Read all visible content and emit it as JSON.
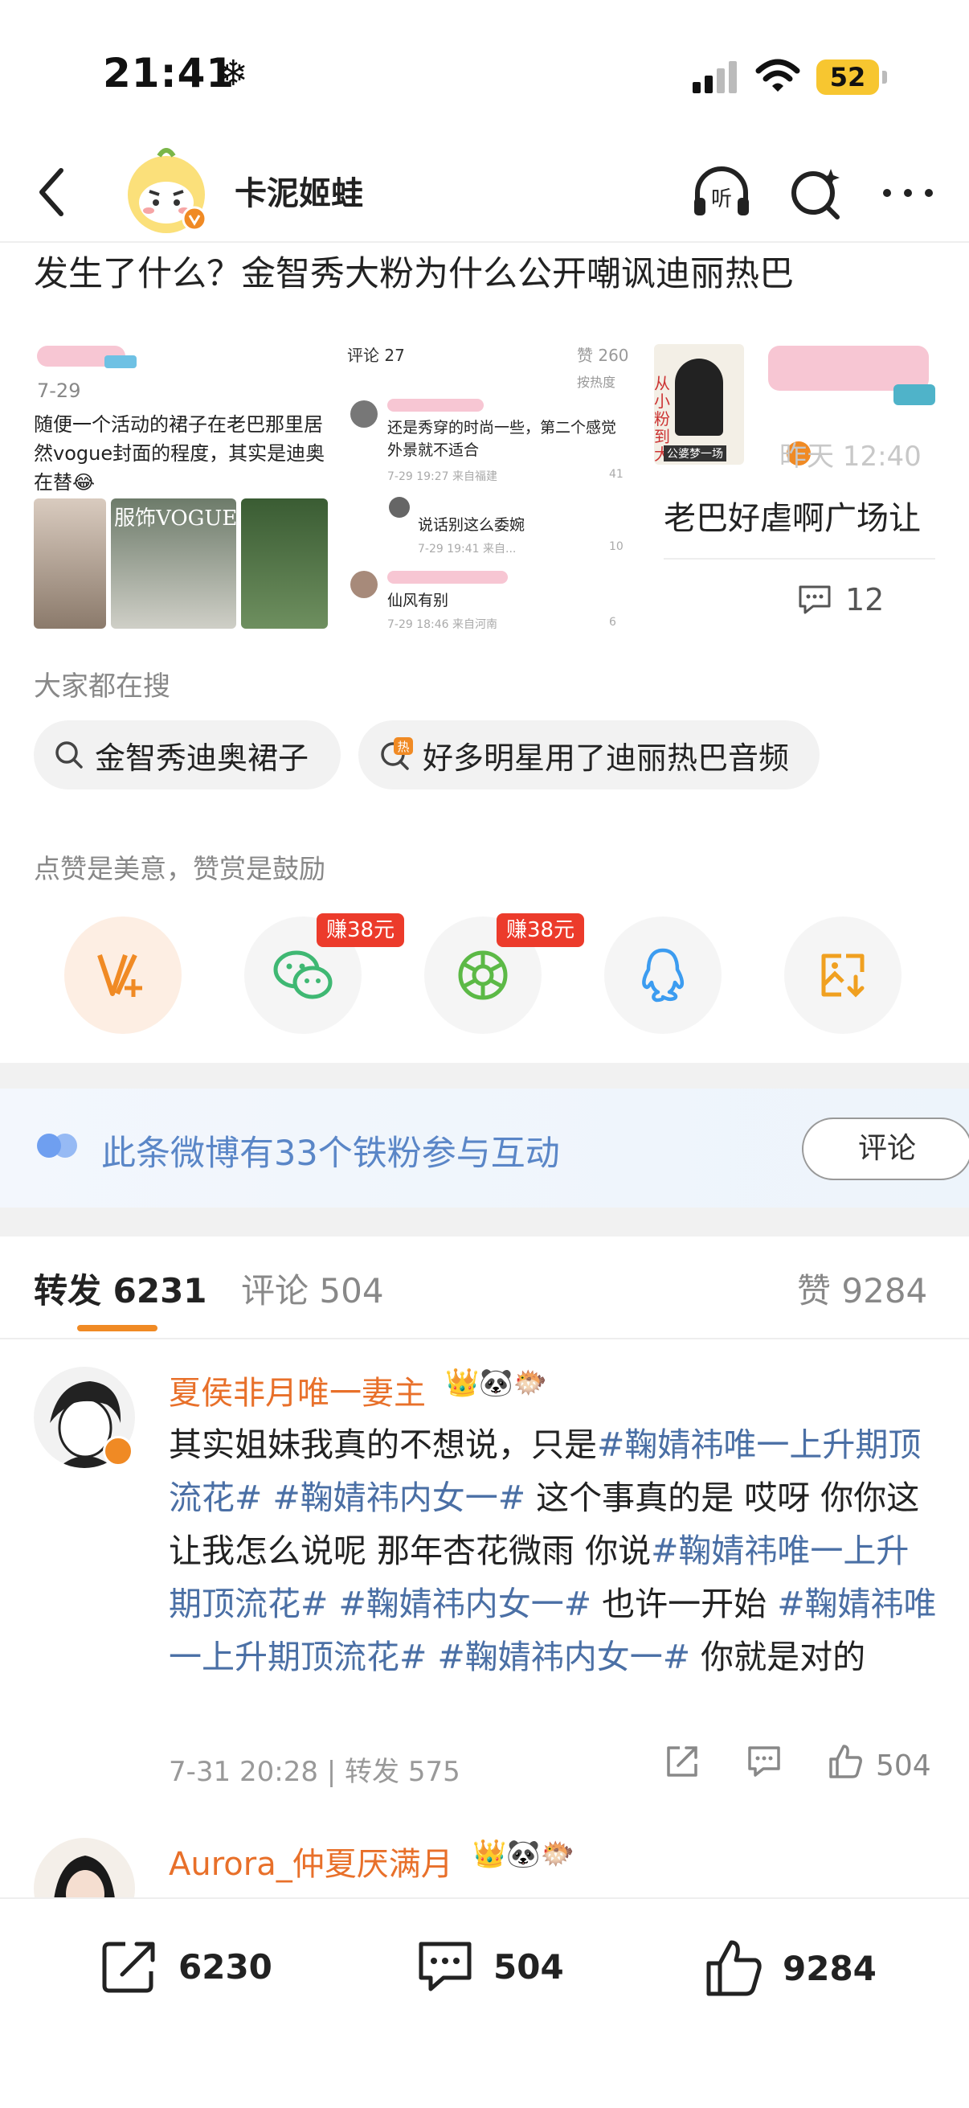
{
  "status_bar": {
    "time": "21:41",
    "weather_icon": "snowflake-icon",
    "battery": "52"
  },
  "nav": {
    "account_name": "卡泥姬蛙"
  },
  "post": {
    "title": "发生了什么？金智秀大粉为什么公开嘲讽迪丽热巴"
  },
  "cards": [
    {
      "date": "7-29",
      "text": "随便一个活动的裙子在老巴那里居然vogue封面的程度，其实是迪奥在替",
      "emoji": "😂",
      "photo_caption": "服饰VOGUE美容"
    },
    {
      "comment_header": "评论 27",
      "likes_header": "赞 260",
      "sort_label": "按热度",
      "comments": [
        {
          "text": "还是秀穿的时尚一些，第二个感觉外景就不适合",
          "meta": "7-29 19:27 来自福建",
          "likes": "41"
        },
        {
          "text": "说话别这么委婉",
          "meta": "7-29 19:41 来自...",
          "likes": "10"
        },
        {
          "text": "仙风有别",
          "meta": "7-29 18:46 来自河南",
          "likes": "6"
        }
      ]
    },
    {
      "time": "昨天 12:40",
      "text": "老巴好虐啊广场让",
      "comment_count": "12",
      "avatar_lines": [
        "从小粉到大",
        "公婆梦一场"
      ]
    }
  ],
  "search": {
    "title": "大家都在搜",
    "items": [
      {
        "label": "金智秀迪奥裙子",
        "icon": "search-icon"
      },
      {
        "label": "好多明星用了迪丽热巴音频",
        "icon": "hot-search-icon"
      }
    ]
  },
  "reward": {
    "note": "点赞是美意，赞赏是鼓励",
    "share_targets": [
      {
        "name": "reward",
        "icon": "v-plus-icon",
        "badge": ""
      },
      {
        "name": "wechat",
        "icon": "wechat-icon",
        "badge": "赚38元"
      },
      {
        "name": "moments",
        "icon": "moments-icon",
        "badge": "赚38元"
      },
      {
        "name": "qq",
        "icon": "qq-icon",
        "badge": ""
      },
      {
        "name": "save",
        "icon": "save-image-icon",
        "badge": ""
      }
    ]
  },
  "fans_banner": {
    "text": "此条微博有33个铁粉参与互动",
    "button": "评论"
  },
  "tabs": {
    "repost_label": "转发",
    "repost_count": "6231",
    "comment_label": "评论",
    "comment_count": "504",
    "like_label": "赞",
    "like_count": "9284"
  },
  "comments": [
    {
      "username": "夏侯非月唯一妻主",
      "parts": [
        {
          "t": "其实姐妹我真的不想说，只是",
          "tag": false
        },
        {
          "t": "#鞠婧祎唯一上升期顶流花#",
          "tag": true
        },
        {
          "t": " ",
          "tag": false
        },
        {
          "t": "#鞠婧祎内女一#",
          "tag": true
        },
        {
          "t": " 这个事真的是 哎呀 你你这让我怎么说呢 那年杏花微雨 你说",
          "tag": false
        },
        {
          "t": "#鞠婧祎唯一上升期顶流花#",
          "tag": true
        },
        {
          "t": " ",
          "tag": false
        },
        {
          "t": "#鞠婧祎内女一#",
          "tag": true
        },
        {
          "t": " 也许一开始 ",
          "tag": false
        },
        {
          "t": "#鞠婧祎唯一上升期顶流花#",
          "tag": true
        },
        {
          "t": " ",
          "tag": false
        },
        {
          "t": "#鞠婧祎内女一#",
          "tag": true
        },
        {
          "t": " 你就是对的",
          "tag": false
        }
      ],
      "meta": "7-31 20:28 | 转发 575",
      "likes": "504"
    },
    {
      "username": "Aurora_仲夏厌满月"
    }
  ],
  "bottom_bar": {
    "repost": "6230",
    "comment": "504",
    "like": "9284"
  },
  "colors": {
    "accent_orange": "#f08a24",
    "link_blue": "#4a6fa5",
    "fans_blue": "#5a86c7",
    "badge_red": "#ec3b2b"
  }
}
